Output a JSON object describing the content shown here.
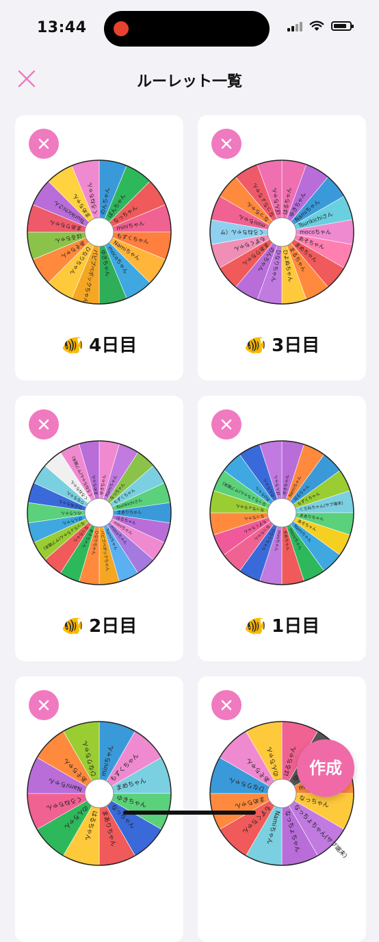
{
  "status": {
    "time": "13:44",
    "battery_level": 0.8
  },
  "nav": {
    "title": "ルーレット一覧"
  },
  "fab": {
    "label": "作成"
  },
  "icons": {
    "fish": "🐠",
    "close": "close-icon",
    "delete": "delete-icon"
  },
  "colors": {
    "accent": "#f07ac0",
    "fab": "#f06aa8",
    "background": "#f2f2f7"
  },
  "cards": [
    {
      "title": "4日目",
      "segments": [
        {
          "label": "のんちゃん",
          "color": "#3a9ad9"
        },
        {
          "label": "ぽんちゃん",
          "color": "#2eb85c"
        },
        {
          "label": "なっちゃん",
          "color": "#f05a5a"
        },
        {
          "label": "miniちゃん",
          "color": "#f06292"
        },
        {
          "label": "もずくちゃん",
          "color": "#ff7f3f"
        },
        {
          "label": "Namiちゃん",
          "color": "#ffb43a"
        },
        {
          "label": "mocoちゃん",
          "color": "#3fa8e0"
        },
        {
          "label": "ゆきちゃん",
          "color": "#2fae5a"
        },
        {
          "label": "パピプペポックちゃん",
          "color": "#f5a623"
        },
        {
          "label": "ひなりちゃん",
          "color": "#ffc93c"
        },
        {
          "label": "あそちゃん",
          "color": "#ff8a3d"
        },
        {
          "label": "はるちゃん",
          "color": "#8bc34a"
        },
        {
          "label": "まありちゃん",
          "color": "#ef5a6a"
        },
        {
          "label": "Tsurikichiさん",
          "color": "#b86dd9"
        },
        {
          "label": "まめちゃん",
          "color": "#ffd23f"
        },
        {
          "label": "くろねちゃん",
          "color": "#f08ad0"
        }
      ]
    },
    {
      "title": "3日目",
      "segments": [
        {
          "label": "はるちゃん",
          "color": "#f06fb0"
        },
        {
          "label": "ゆきちゃん",
          "color": "#b86dd9"
        },
        {
          "label": "Namiちゃん",
          "color": "#3a9ad9"
        },
        {
          "label": "Tsurikichiさん",
          "color": "#6ad0e0"
        },
        {
          "label": "mocoちゃん",
          "color": "#f08ad0"
        },
        {
          "label": "あそちゃん",
          "color": "#ff7fb0"
        },
        {
          "label": "まめちゃん",
          "color": "#f05a5a"
        },
        {
          "label": "まるちゃん",
          "color": "#ff8a3d"
        },
        {
          "label": "ひよぬちゃん",
          "color": "#ffc93c"
        },
        {
          "label": "ひなりちゃん",
          "color": "#c17ae0"
        },
        {
          "label": "のんちゃん",
          "color": "#b86dd9"
        },
        {
          "label": "まありちゃん",
          "color": "#f05a5a"
        },
        {
          "label": "もずくちゃん",
          "color": "#ef8fb5"
        },
        {
          "label": "くろねちゃん（サ",
          "color": "#8fd0f0"
        },
        {
          "label": "miniちゃん",
          "color": "#f06292"
        },
        {
          "label": "なっちゃん",
          "color": "#ff8a3d"
        },
        {
          "label": "なっちょちゃん",
          "color": "#ef5a6a"
        },
        {
          "label": "ぽんちゃん",
          "color": "#f06fb0"
        }
      ]
    },
    {
      "title": "2日目",
      "segments": [
        {
          "label": "ゆきちゃん",
          "color": "#f08ad0"
        },
        {
          "label": "Namiちゃん",
          "color": "#c17ae0"
        },
        {
          "label": "なっちゃん",
          "color": "#8bc34a"
        },
        {
          "label": "もずくちゃん",
          "color": "#7ad0e0"
        },
        {
          "label": "Tsurikichiさん",
          "color": "#5ad17a"
        },
        {
          "label": "まありちゃん",
          "color": "#3a9ad9"
        },
        {
          "label": "はるちゃん",
          "color": "#b86dd9"
        },
        {
          "label": "miniちゃん",
          "color": "#f08ad0"
        },
        {
          "label": "mocoちゃん",
          "color": "#a57ae0"
        },
        {
          "label": "Namiちゃん",
          "color": "#5ab0f0"
        },
        {
          "label": "パピプペポックちゃん",
          "color": "#f5a623"
        },
        {
          "label": "ひなりちゃん",
          "color": "#ff8a3d"
        },
        {
          "label": "あそちゃん",
          "color": "#2eb85c"
        },
        {
          "label": "なっちゃん",
          "color": "#f05a5a"
        },
        {
          "label": "なっちょちゃん(サブ端末)",
          "color": "#9acd32"
        },
        {
          "label": "ぽんちゃん",
          "color": "#3fa8e0"
        },
        {
          "label": "のんちゃん",
          "color": "#5ad17a"
        },
        {
          "label": "ひよぬちゃん",
          "color": "#3a6ad9"
        },
        {
          "label": "りなちゃん",
          "color": "#7ad0e0"
        },
        {
          "label": "くろねちゃん",
          "color": "#f0f0f0"
        },
        {
          "label": "くろねちゃん(サブ端末)",
          "color": "#f08ad0"
        },
        {
          "label": "まめちゃん",
          "color": "#b86dd9"
        }
      ]
    },
    {
      "title": "1日目",
      "segments": [
        {
          "label": "ゆきちゃん",
          "color": "#b86dd9"
        },
        {
          "label": "Namiちゃん",
          "color": "#ff8a3d"
        },
        {
          "label": "はるちゃん",
          "color": "#3a9ad9"
        },
        {
          "label": "もずくちゃん",
          "color": "#9acd32"
        },
        {
          "label": "くろねちゃん(サブ端末)",
          "color": "#7ad0e0"
        },
        {
          "label": "まありちゃん",
          "color": "#5ad17a"
        },
        {
          "label": "あそちゃん",
          "color": "#f5d020"
        },
        {
          "label": "Namiちゃん",
          "color": "#3fa8e0"
        },
        {
          "label": "mocoちゃん",
          "color": "#2eb85c"
        },
        {
          "label": "まめちゃん",
          "color": "#f05a5a"
        },
        {
          "label": "miniちゃん",
          "color": "#c17ae0"
        },
        {
          "label": "ひなりちゃん",
          "color": "#3a6ad9"
        },
        {
          "label": "なっちゃん",
          "color": "#f06292"
        },
        {
          "label": "もずくちゃん",
          "color": "#f05a9a"
        },
        {
          "label": "なっちゃん",
          "color": "#ff8a3d"
        },
        {
          "label": "なっちょちゃん",
          "color": "#9acd32"
        },
        {
          "label": "なっちょちゃん(サブ端末)",
          "color": "#5ad17a"
        },
        {
          "label": "Rioちゃん",
          "color": "#3fa8e0"
        },
        {
          "label": "のんちゃん",
          "color": "#3a6ad9"
        },
        {
          "label": "ぽんちゃん",
          "color": "#c17ae0"
        }
      ]
    },
    {
      "title": "",
      "segments": [
        {
          "label": "miniちゃん",
          "color": "#3a9ad9"
        },
        {
          "label": "もずくちゃん",
          "color": "#f08ad0"
        },
        {
          "label": "まめちゃん",
          "color": "#7ad0e0"
        },
        {
          "label": "ゆきちゃん",
          "color": "#5ad17a"
        },
        {
          "label": "なっちゃん",
          "color": "#3a6ad9"
        },
        {
          "label": "まありちゃん",
          "color": "#f05a5a"
        },
        {
          "label": "はるちゃん",
          "color": "#ffc93c"
        },
        {
          "label": "のんちゃん",
          "color": "#2eb85c"
        },
        {
          "label": "くろねちゃん",
          "color": "#f06292"
        },
        {
          "label": "Namiちゃん",
          "color": "#b86dd9"
        },
        {
          "label": "あそちゃん",
          "color": "#ff8a3d"
        },
        {
          "label": "ひなりちゃん",
          "color": "#9acd32"
        }
      ]
    },
    {
      "title": "",
      "segments": [
        {
          "label": "はるちゃん",
          "color": "#f06292"
        },
        {
          "label": "ゆきちゃん",
          "color": "#555555"
        },
        {
          "label": "mocoちゃん",
          "color": "#ff8a3d"
        },
        {
          "label": "なっちゃん",
          "color": "#ffc93c"
        },
        {
          "label": "なっちょちゃん(サブ端末)",
          "color": "#c17ae0"
        },
        {
          "label": "なっちょちゃん",
          "color": "#b86dd9"
        },
        {
          "label": "Namiちゃん",
          "color": "#7ad0e0"
        },
        {
          "label": "もずくちゃん",
          "color": "#f05a5a"
        },
        {
          "label": "まめちゃん",
          "color": "#ff8a3d"
        },
        {
          "label": "ひなりちゃん",
          "color": "#3a9ad9"
        },
        {
          "label": "あそちゃん",
          "color": "#f08ad0"
        },
        {
          "label": "のんちゃん",
          "color": "#ffc93c"
        }
      ]
    }
  ]
}
